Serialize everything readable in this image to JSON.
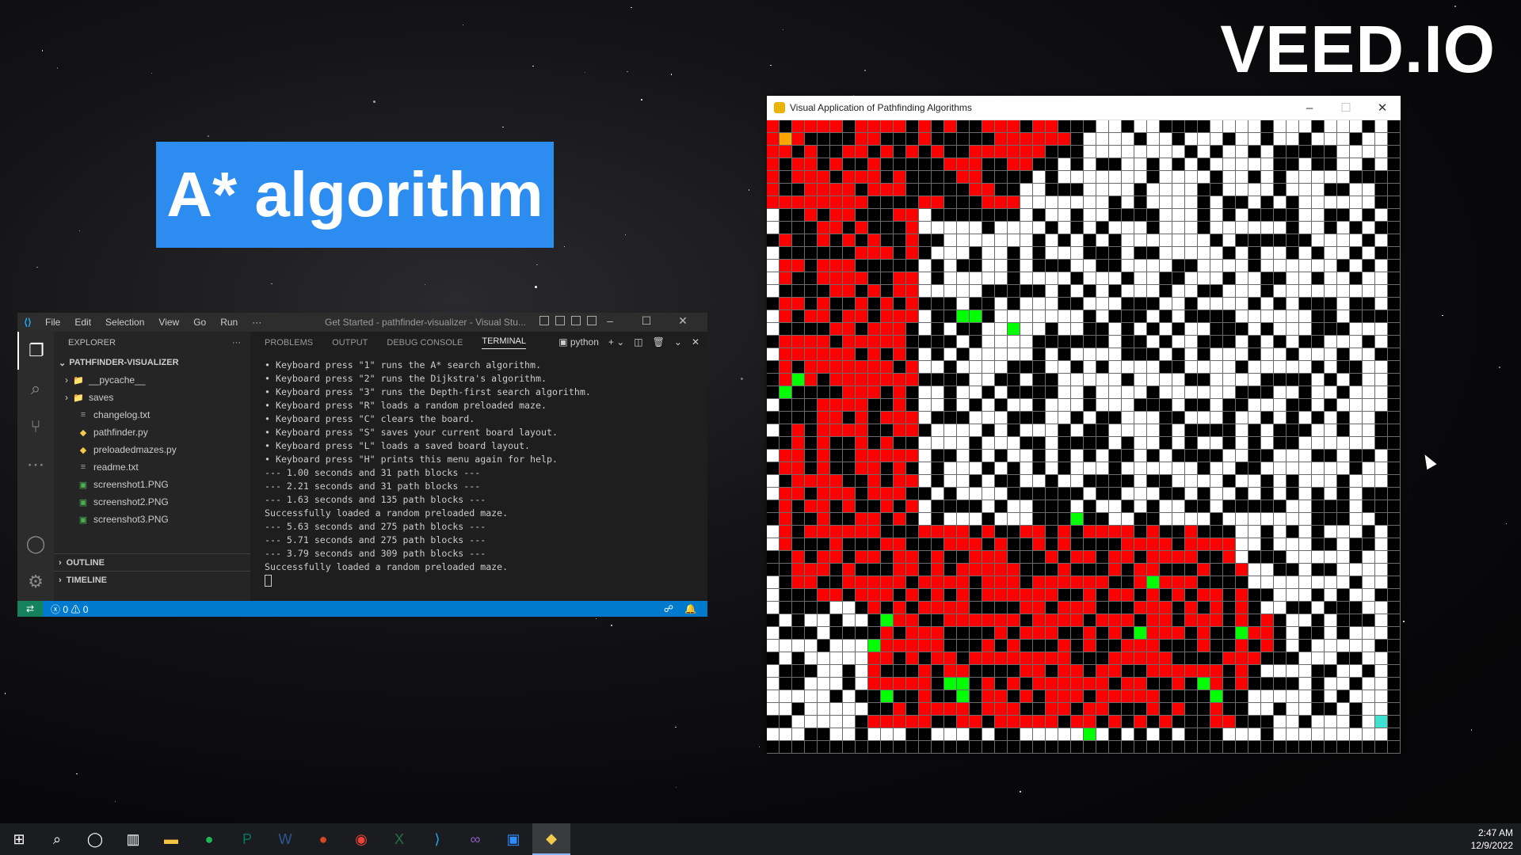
{
  "watermark": "VEED.IO",
  "banner": {
    "title": "A* algorithm"
  },
  "vscode": {
    "menu": [
      "File",
      "Edit",
      "Selection",
      "View",
      "Go",
      "Run",
      "···"
    ],
    "window_title": "Get Started - pathfinder-visualizer - Visual Stu...",
    "explorer": {
      "header": "EXPLORER",
      "root": "PATHFINDER-VISUALIZER",
      "items": [
        {
          "label": "__pycache__",
          "type": "folder"
        },
        {
          "label": "saves",
          "type": "folder"
        },
        {
          "label": "changelog.txt",
          "type": "txt"
        },
        {
          "label": "pathfinder.py",
          "type": "py"
        },
        {
          "label": "preloadedmazes.py",
          "type": "py"
        },
        {
          "label": "readme.txt",
          "type": "txt"
        },
        {
          "label": "screenshot1.PNG",
          "type": "png"
        },
        {
          "label": "screenshot2.PNG",
          "type": "png"
        },
        {
          "label": "screenshot3.PNG",
          "type": "png"
        }
      ],
      "outline": "OUTLINE",
      "timeline": "TIMELINE"
    },
    "panel_tabs": [
      "PROBLEMS",
      "OUTPUT",
      "DEBUG CONSOLE",
      "TERMINAL"
    ],
    "terminal_selector": "python",
    "terminal_lines": [
      "• Keyboard press \"1\" runs the A* search algorithm.",
      "• Keyboard press \"2\" runs the Dijkstra's algorithm.",
      "• Keyboard press \"3\" runs the Depth-first search algorithm.",
      "• Keyboard press \"R\" loads a random preloaded maze.",
      "• Keyboard press \"C\" clears the board.",
      "• Keyboard press \"S\" saves your current board layout.",
      "• Keyboard press \"L\" loads a saved board layout.",
      "• Keyboard press \"H\" prints this menu again for help.",
      "--- 1.00 seconds and 31 path blocks ---",
      "--- 2.21 seconds and 31 path blocks ---",
      "--- 1.63 seconds and 135 path blocks ---",
      "Successfully loaded a random preloaded maze.",
      "--- 5.63 seconds and 275 path blocks ---",
      "--- 5.71 seconds and 275 path blocks ---",
      "--- 3.79 seconds and 309 path blocks ---",
      "Successfully loaded a random preloaded maze."
    ],
    "status": {
      "errors": "0",
      "warnings": "0"
    }
  },
  "pygame": {
    "title": "Visual Application of Pathfinding Algorithms",
    "colors": {
      "wall": "#000000",
      "open": "#ffffff",
      "visited": "#ff0000",
      "frontier": "#00ff00",
      "start": "#ffa500",
      "end": "#40e0d0",
      "gridline": "#6a6a6a"
    }
  },
  "taskbar": {
    "icons": [
      "windows-start-icon",
      "search-icon",
      "cortana-icon",
      "task-view-icon",
      "file-explorer-icon",
      "spotify-icon",
      "publisher-icon",
      "word-icon",
      "powerpoint-icon",
      "chrome-icon",
      "excel-icon",
      "vscode-icon",
      "visual-studio-icon",
      "zoom-icon",
      "python-icon"
    ],
    "time": "2:47 AM",
    "date": "12/9/2022"
  }
}
